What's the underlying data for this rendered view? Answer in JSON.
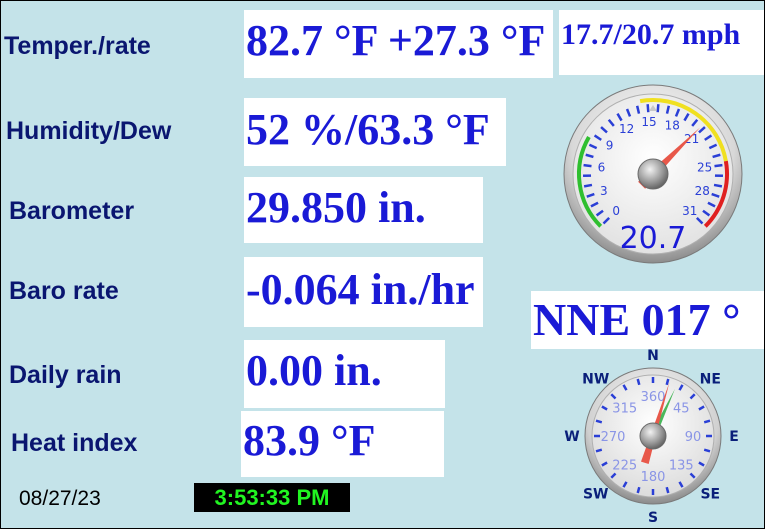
{
  "labels": {
    "temperature": "Temper./rate",
    "humidity": "Humidity/Dew",
    "barometer": "Barometer",
    "baro_rate": "Baro rate",
    "daily_rain": "Daily rain",
    "heat_index": "Heat index"
  },
  "values": {
    "temperature": "82.7 °F +27.3 °F",
    "humidity": "52 %/63.3 °F",
    "barometer": "29.850 in.",
    "baro_rate": "-0.064 in./hr",
    "daily_rain": "0.00 in.",
    "heat_index": "83.9 °F"
  },
  "wind": {
    "speed_text": "17.7/20.7 mph",
    "gust_value": "20.7",
    "gauge_ticks": [
      "0",
      "3",
      "6",
      "9",
      "12",
      "15",
      "18",
      "21",
      "25",
      "28",
      "31"
    ],
    "gauge_min": 0,
    "gauge_max": 31,
    "needle_value": 20.7,
    "trail_value": 17.7,
    "direction_text": "NNE  017 °",
    "direction_deg": 17,
    "compass_points": [
      "N",
      "NE",
      "E",
      "SE",
      "S",
      "SW",
      "W",
      "NW"
    ],
    "compass_ticks": [
      "360",
      "45",
      "90",
      "135",
      "180",
      "225",
      "270",
      "315"
    ]
  },
  "footer": {
    "date": "08/27/23",
    "time": "3:53:33 PM"
  },
  "colors": {
    "label": "#0a1670",
    "value": "#1a1ad6",
    "background": "#c4e3e9",
    "clock_text": "#21f521",
    "needle": "#e8584a",
    "needle_trail": "#36b04a"
  }
}
